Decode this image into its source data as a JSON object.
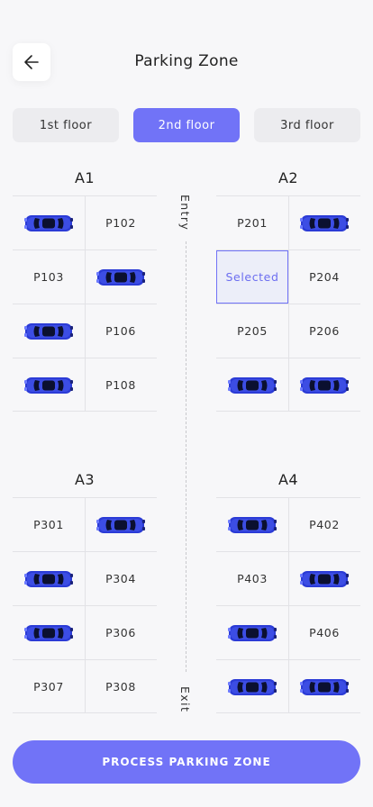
{
  "header": {
    "title": "Parking Zone",
    "back_icon": "arrow-left-icon"
  },
  "floors": [
    {
      "label": "1st floor",
      "active": false
    },
    {
      "label": "2nd floor",
      "active": true
    },
    {
      "label": "3rd floor",
      "active": false
    }
  ],
  "lane": {
    "entry_label": "Entry",
    "exit_label": "Exit"
  },
  "sections": {
    "a1": {
      "label": "A1",
      "rows": [
        [
          {
            "type": "car"
          },
          {
            "type": "spot",
            "label": "P102"
          }
        ],
        [
          {
            "type": "spot",
            "label": "P103"
          },
          {
            "type": "car"
          }
        ],
        [
          {
            "type": "car"
          },
          {
            "type": "spot",
            "label": "P106"
          }
        ],
        [
          {
            "type": "car"
          },
          {
            "type": "spot",
            "label": "P108"
          }
        ]
      ]
    },
    "a2": {
      "label": "A2",
      "rows": [
        [
          {
            "type": "spot",
            "label": "P201"
          },
          {
            "type": "car"
          }
        ],
        [
          {
            "type": "selected",
            "label": "Selected"
          },
          {
            "type": "spot",
            "label": "P204"
          }
        ],
        [
          {
            "type": "spot",
            "label": "P205"
          },
          {
            "type": "spot",
            "label": "P206"
          }
        ],
        [
          {
            "type": "car"
          },
          {
            "type": "car"
          }
        ]
      ]
    },
    "a3": {
      "label": "A3",
      "rows": [
        [
          {
            "type": "spot",
            "label": "P301"
          },
          {
            "type": "car"
          }
        ],
        [
          {
            "type": "car"
          },
          {
            "type": "spot",
            "label": "P304"
          }
        ],
        [
          {
            "type": "car"
          },
          {
            "type": "spot",
            "label": "P306"
          }
        ],
        [
          {
            "type": "spot",
            "label": "P307"
          },
          {
            "type": "spot",
            "label": "P308"
          }
        ]
      ]
    },
    "a4": {
      "label": "A4",
      "rows": [
        [
          {
            "type": "car"
          },
          {
            "type": "spot",
            "label": "P402"
          }
        ],
        [
          {
            "type": "spot",
            "label": "P403"
          },
          {
            "type": "car"
          }
        ],
        [
          {
            "type": "car"
          },
          {
            "type": "spot",
            "label": "P406"
          }
        ],
        [
          {
            "type": "car"
          },
          {
            "type": "car"
          }
        ]
      ]
    }
  },
  "action": {
    "label": "PROCESS PARKING ZONE"
  },
  "colors": {
    "accent": "#7173f7",
    "car_body": "#2b3bd6",
    "car_window": "#0b1030"
  }
}
